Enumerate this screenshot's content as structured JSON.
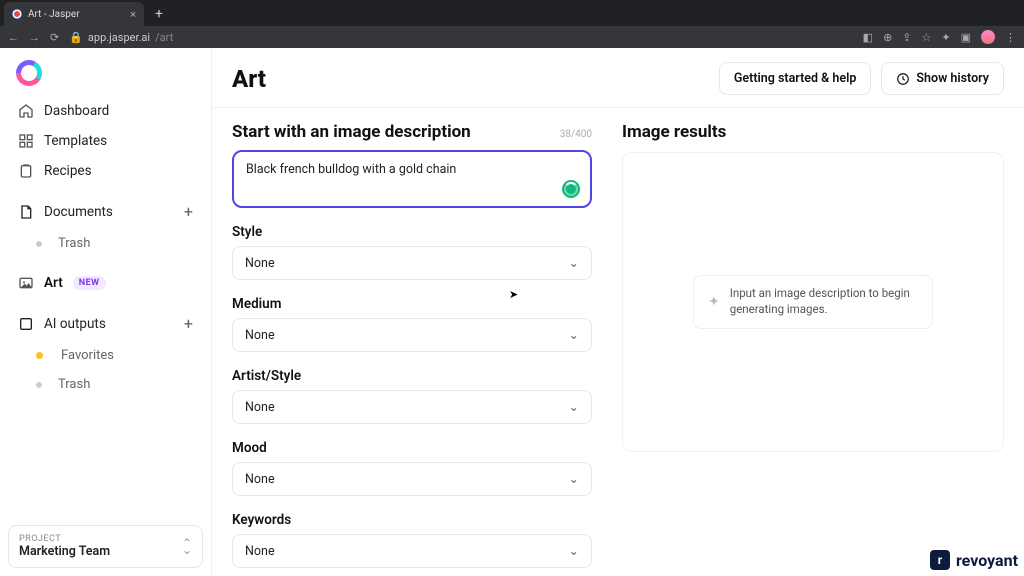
{
  "chrome": {
    "tab_title": "Art - Jasper",
    "url_host": "app.jasper.ai",
    "url_path": "/art"
  },
  "sidebar": {
    "items": [
      {
        "label": "Dashboard"
      },
      {
        "label": "Templates"
      },
      {
        "label": "Recipes"
      }
    ],
    "documents_label": "Documents",
    "trash_label": "Trash",
    "art_label": "Art",
    "art_badge": "NEW",
    "ai_outputs_label": "AI outputs",
    "favorites_label": "Favorites",
    "trash2_label": "Trash",
    "project_small": "PROJECT",
    "project_name": "Marketing Team"
  },
  "header": {
    "title": "Art",
    "getting_started": "Getting started & help",
    "show_history": "Show history"
  },
  "form": {
    "section_title": "Start with an image description",
    "counter": "38/400",
    "prompt_value": "Black french bulldog with a gold chain",
    "fields": [
      {
        "label": "Style",
        "value": "None"
      },
      {
        "label": "Medium",
        "value": "None"
      },
      {
        "label": "Artist/Style",
        "value": "None"
      },
      {
        "label": "Mood",
        "value": "None"
      },
      {
        "label": "Keywords",
        "value": "None"
      }
    ]
  },
  "results": {
    "title": "Image results",
    "hint": "Input an image description to begin generating images."
  },
  "watermark": "revoyant"
}
